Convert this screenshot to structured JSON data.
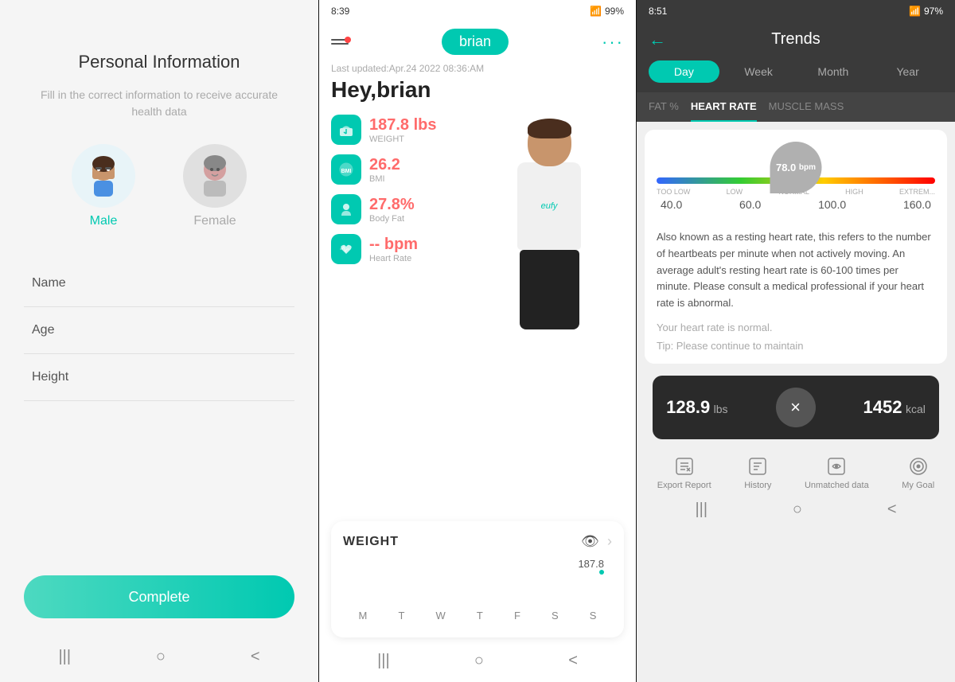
{
  "panel1": {
    "title": "Personal Information",
    "subtitle": "Fill in the correct information to receive accurate health data",
    "genders": [
      {
        "id": "male",
        "label": "Male",
        "selected": true
      },
      {
        "id": "female",
        "label": "Female",
        "selected": false
      }
    ],
    "fields": [
      {
        "id": "name",
        "label": "Name"
      },
      {
        "id": "age",
        "label": "Age"
      },
      {
        "id": "height",
        "label": "Height"
      }
    ],
    "complete_btn": "Complete",
    "nav": [
      "|||",
      "○",
      "<"
    ]
  },
  "panel2": {
    "status_bar": {
      "time": "8:39",
      "battery": "99%"
    },
    "username": "brian",
    "menu_dots": "···",
    "last_updated": "Last updated:Apr.24 2022 08:36:AM",
    "greeting": "Hey,brian",
    "metrics": [
      {
        "icon": "⚖",
        "value": "187.8 lbs",
        "label": "WEIGHT"
      },
      {
        "icon": "📊",
        "value": "26.2",
        "label": "BMI"
      },
      {
        "icon": "💪",
        "value": "27.8%",
        "label": "Body Fat"
      },
      {
        "icon": "❤",
        "value": "-- bpm",
        "label": "Heart Rate"
      }
    ],
    "weight_card": {
      "label": "WEIGHT",
      "value": "187.8",
      "days": [
        "M",
        "T",
        "W",
        "T",
        "F",
        "S",
        "S"
      ]
    },
    "nav": [
      "|||",
      "○",
      "<"
    ]
  },
  "panel3": {
    "status_bar": {
      "time": "8:51",
      "battery": "97%"
    },
    "title": "Trends",
    "back": "←",
    "time_tabs": [
      {
        "label": "Day",
        "active": true
      },
      {
        "label": "Week",
        "active": false
      },
      {
        "label": "Month",
        "active": false
      },
      {
        "label": "Year",
        "active": false
      }
    ],
    "metric_tabs": [
      {
        "label": "FAT %",
        "active": false
      },
      {
        "label": "HEART RATE",
        "active": true
      },
      {
        "label": "MUSCLE MASS",
        "active": false
      }
    ],
    "heart_rate": {
      "value": "78.0",
      "unit": "bpm",
      "gauge_labels": [
        "TOO LOW",
        "LOW",
        "NORMAL",
        "HIGH",
        "EXTREM..."
      ],
      "gauge_values": [
        "40.0",
        "60.0",
        "100.0",
        "160.0"
      ],
      "description": "Also known as a resting heart rate, this refers to the number of heartbeats per minute when not actively moving. An average adult's resting heart rate is 60-100 times per minute. Please consult a medical professional if your heart rate is abnormal.",
      "status": "Your heart rate is normal.",
      "tip": "Tip: Please continue to maintain"
    },
    "bottom_stats": [
      {
        "value": "128.9",
        "unit": "lbs"
      },
      {
        "value": "1452",
        "unit": "kcal"
      }
    ],
    "bottom_nav": [
      {
        "label": "Export Report",
        "icon": "📤"
      },
      {
        "label": "History",
        "icon": "📋"
      },
      {
        "label": "Unmatched data",
        "icon": "🔄"
      },
      {
        "label": "My Goal",
        "icon": "🎯"
      }
    ],
    "nav": [
      "|||",
      "○",
      "<"
    ],
    "close_icon": "×"
  }
}
